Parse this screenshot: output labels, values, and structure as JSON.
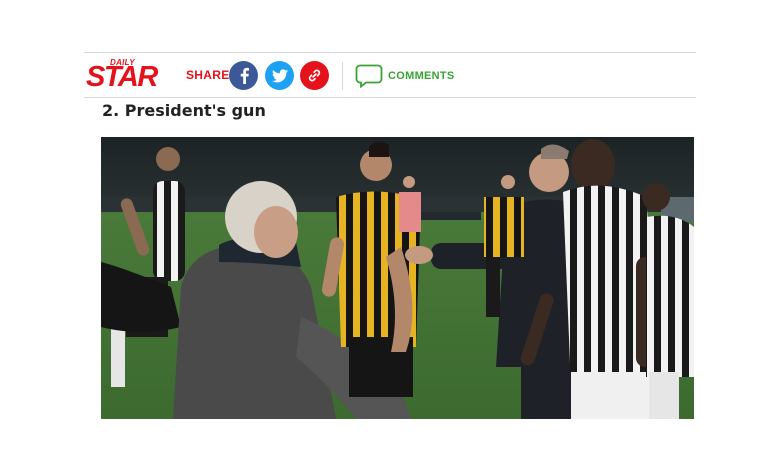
{
  "brand": {
    "daily": "DAILY",
    "star": "STAR",
    "color": "#e4121b"
  },
  "share": {
    "label": "SHARE",
    "buttons": [
      {
        "name": "facebook",
        "icon": "facebook-icon",
        "color": "#3b5998"
      },
      {
        "name": "twitter",
        "icon": "twitter-icon",
        "color": "#1da1f2"
      },
      {
        "name": "copy-link",
        "icon": "link-icon",
        "color": "#e4121b"
      }
    ]
  },
  "comments": {
    "label": "COMMENTS",
    "icon": "speech-bubble-icon",
    "color": "#3aa335"
  },
  "article": {
    "headline": "2. President's gun"
  },
  "photo": {
    "description_icon": "football-players-photo",
    "sponsor_text": ""
  }
}
